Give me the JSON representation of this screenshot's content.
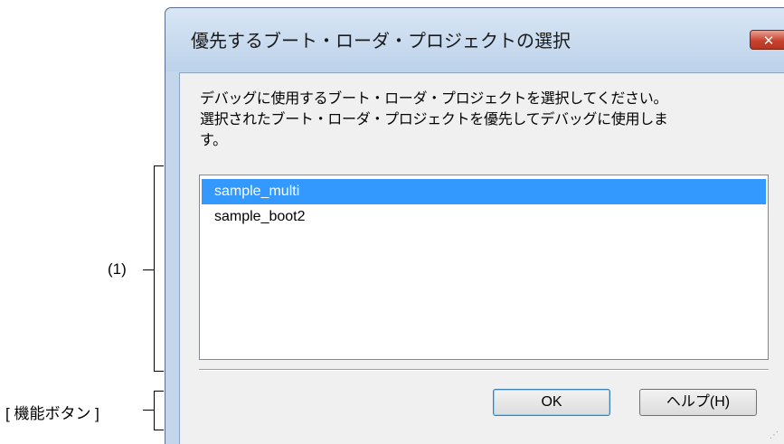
{
  "annotations": {
    "list_label": "(1)",
    "buttons_label": "[ 機能ボタン ]"
  },
  "dialog": {
    "title": "優先するブート・ローダ・プロジェクトの選択",
    "close_label": "✕",
    "description": "デバッグに使用するブート・ローダ・プロジェクトを選択してください。\n選択されたブート・ローダ・プロジェクトを優先してデバッグに使用しま\nす。",
    "list": {
      "items": [
        {
          "label": "sample_multi",
          "selected": true
        },
        {
          "label": "sample_boot2",
          "selected": false
        }
      ]
    },
    "buttons": {
      "ok_label": "OK",
      "help_label": "ヘルプ(H)"
    }
  },
  "colors": {
    "selection": "#3399ff",
    "close_button": "#c7432f",
    "window_frame": "#c3d6ec"
  }
}
